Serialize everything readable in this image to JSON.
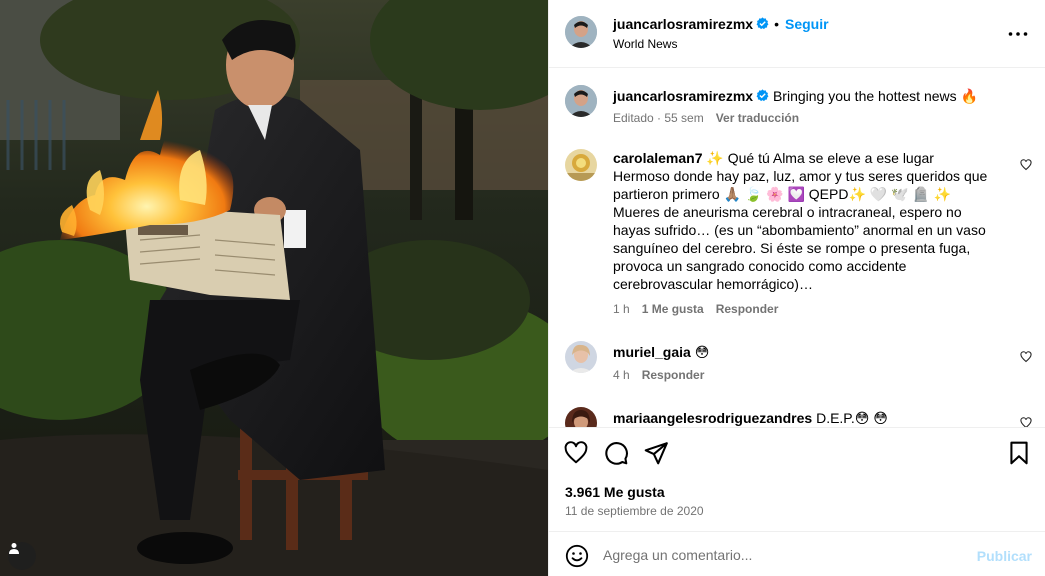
{
  "post_owner": {
    "username": "juancarlosramirezmx",
    "follow_label": "Seguir",
    "location": "World News",
    "dot": "•"
  },
  "caption": {
    "username": "juancarlosramirezmx",
    "text": "Bringing you the hottest news 🔥",
    "edited": "Editado · 55 sem",
    "translate": "Ver traducción"
  },
  "comments": [
    {
      "username": "carolaleman7",
      "text": "✨ Qué tú Alma se eleve a ese lugar Hermoso donde hay paz, luz, amor y tus seres queridos que partieron primero 🙏🏽 🍃 🌸 💟 QEPD✨ 🤍 🕊️ 🪦 ✨ Mueres de aneurisma cerebral o intracraneal, espero no hayas sufrido… (es un “abombamiento” anormal en un vaso sanguíneo del cerebro. Si éste se rompe o presenta fuga, provoca un sangrado conocido como accidente cerebrovascular hemorrágico)…",
      "time": "1 h",
      "likes": "1 Me gusta",
      "reply": "Responder"
    },
    {
      "username": "muriel_gaia",
      "text": "😳",
      "time": "4 h",
      "reply": "Responder"
    },
    {
      "username": "mariaangelesrodriguezandres",
      "text": "D.E.P.😳 😳"
    }
  ],
  "stats": {
    "likes": "3.961 Me gusta",
    "date": "11 de septiembre de 2020"
  },
  "composer": {
    "placeholder": "Agrega un comentario...",
    "publish": "Publicar"
  },
  "icons": {
    "verified": "verified-badge-icon",
    "more": "more-options-icon",
    "like": "heart-icon",
    "comment": "comment-icon",
    "share": "share-icon",
    "save": "bookmark-icon",
    "emoji": "emoji-icon",
    "tag": "user-tag-icon"
  },
  "colors": {
    "link_blue": "#0095f6",
    "publish_disabled": "#b2dffc",
    "muted_text": "#737373",
    "verified_blue": "#0095f6"
  }
}
